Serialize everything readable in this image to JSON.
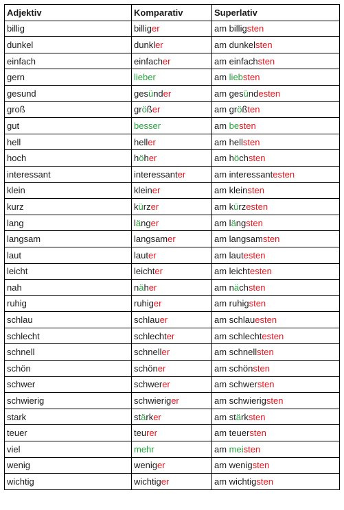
{
  "headers": [
    "Adjektiv",
    "Komparativ",
    "Superlativ"
  ],
  "colors": {
    "red": "#e8121b",
    "green": "#22a33a",
    "text": "#1a1a1a"
  },
  "rows": [
    {
      "adj": "billig",
      "komp": [
        [
          "billig",
          ""
        ],
        [
          "er",
          "r"
        ]
      ],
      "sup": [
        [
          "am billig",
          ""
        ],
        [
          "sten",
          "r"
        ]
      ]
    },
    {
      "adj": "dunkel",
      "komp": [
        [
          "dunkl",
          ""
        ],
        [
          "er",
          "r"
        ]
      ],
      "sup": [
        [
          "am dunkel",
          ""
        ],
        [
          "sten",
          "r"
        ]
      ]
    },
    {
      "adj": "einfach",
      "komp": [
        [
          "einfach",
          ""
        ],
        [
          "er",
          "r"
        ]
      ],
      "sup": [
        [
          "am einfach",
          ""
        ],
        [
          "sten",
          "r"
        ]
      ]
    },
    {
      "adj": "gern",
      "komp": [
        [
          "lieber",
          "g"
        ]
      ],
      "sup": [
        [
          "am ",
          ""
        ],
        [
          "lieb",
          "g"
        ],
        [
          "sten",
          "r"
        ]
      ]
    },
    {
      "adj": "gesund",
      "komp": [
        [
          "ges",
          ""
        ],
        [
          "ü",
          "g"
        ],
        [
          "nd",
          ""
        ],
        [
          "er",
          "r"
        ]
      ],
      "sup": [
        [
          "am ges",
          ""
        ],
        [
          "ü",
          "g"
        ],
        [
          "nd",
          ""
        ],
        [
          "esten",
          "r"
        ]
      ]
    },
    {
      "adj": "groß",
      "komp": [
        [
          "gr",
          ""
        ],
        [
          "ö",
          "g"
        ],
        [
          "ß",
          ""
        ],
        [
          "er",
          "r"
        ]
      ],
      "sup": [
        [
          "am gr",
          ""
        ],
        [
          "ö",
          "g"
        ],
        [
          "ß",
          ""
        ],
        [
          "ten",
          "r"
        ]
      ]
    },
    {
      "adj": "gut",
      "komp": [
        [
          "besser",
          "g"
        ]
      ],
      "sup": [
        [
          "am ",
          ""
        ],
        [
          "be",
          "g"
        ],
        [
          "sten",
          "r"
        ]
      ]
    },
    {
      "adj": "hell",
      "komp": [
        [
          "hell",
          ""
        ],
        [
          "er",
          "r"
        ]
      ],
      "sup": [
        [
          "am hell",
          ""
        ],
        [
          "sten",
          "r"
        ]
      ]
    },
    {
      "adj": "hoch",
      "komp": [
        [
          "h",
          ""
        ],
        [
          "ö",
          "g"
        ],
        [
          "h",
          ""
        ],
        [
          "er",
          "r"
        ]
      ],
      "sup": [
        [
          "am h",
          ""
        ],
        [
          "ö",
          "g"
        ],
        [
          "ch",
          ""
        ],
        [
          "sten",
          "r"
        ]
      ]
    },
    {
      "adj": "interessant",
      "komp": [
        [
          "interessant",
          ""
        ],
        [
          "er",
          "r"
        ]
      ],
      "sup": [
        [
          "am interessant",
          ""
        ],
        [
          "esten",
          "r"
        ]
      ]
    },
    {
      "adj": "klein",
      "komp": [
        [
          "klein",
          ""
        ],
        [
          "er",
          "r"
        ]
      ],
      "sup": [
        [
          "am klein",
          ""
        ],
        [
          "sten",
          "r"
        ]
      ]
    },
    {
      "adj": "kurz",
      "komp": [
        [
          "k",
          ""
        ],
        [
          "ü",
          "g"
        ],
        [
          "rz",
          ""
        ],
        [
          "er",
          "r"
        ]
      ],
      "sup": [
        [
          "am k",
          ""
        ],
        [
          "ü",
          "g"
        ],
        [
          "rz",
          ""
        ],
        [
          "esten",
          "r"
        ]
      ]
    },
    {
      "adj": "lang",
      "komp": [
        [
          "l",
          ""
        ],
        [
          "ä",
          "g"
        ],
        [
          "ng",
          ""
        ],
        [
          "er",
          "r"
        ]
      ],
      "sup": [
        [
          "am l",
          ""
        ],
        [
          "ä",
          "g"
        ],
        [
          "ng",
          ""
        ],
        [
          "sten",
          "r"
        ]
      ]
    },
    {
      "adj": "langsam",
      "komp": [
        [
          "langsam",
          ""
        ],
        [
          "er",
          "r"
        ]
      ],
      "sup": [
        [
          "am langsam",
          ""
        ],
        [
          "sten",
          "r"
        ]
      ]
    },
    {
      "adj": "laut",
      "komp": [
        [
          "laut",
          ""
        ],
        [
          "er",
          "r"
        ]
      ],
      "sup": [
        [
          "am laut",
          ""
        ],
        [
          "esten",
          "r"
        ]
      ]
    },
    {
      "adj": "leicht",
      "komp": [
        [
          "leicht",
          ""
        ],
        [
          "er",
          "r"
        ]
      ],
      "sup": [
        [
          "am leicht",
          ""
        ],
        [
          "esten",
          "r"
        ]
      ]
    },
    {
      "adj": "nah",
      "komp": [
        [
          "n",
          ""
        ],
        [
          "ä",
          "g"
        ],
        [
          "h",
          ""
        ],
        [
          "er",
          "r"
        ]
      ],
      "sup": [
        [
          "am n",
          ""
        ],
        [
          "ä",
          "g"
        ],
        [
          "ch",
          ""
        ],
        [
          "sten",
          "r"
        ]
      ]
    },
    {
      "adj": "ruhig",
      "komp": [
        [
          "ruhig",
          ""
        ],
        [
          "er",
          "r"
        ]
      ],
      "sup": [
        [
          "am ruhig",
          ""
        ],
        [
          "sten",
          "r"
        ]
      ]
    },
    {
      "adj": "schlau",
      "komp": [
        [
          "schlau",
          ""
        ],
        [
          "er",
          "r"
        ]
      ],
      "sup": [
        [
          "am schlau",
          ""
        ],
        [
          "esten",
          "r"
        ]
      ]
    },
    {
      "adj": "schlecht",
      "komp": [
        [
          "schlecht",
          ""
        ],
        [
          "er",
          "r"
        ]
      ],
      "sup": [
        [
          "am schlecht",
          ""
        ],
        [
          "esten",
          "r"
        ]
      ]
    },
    {
      "adj": "schnell",
      "komp": [
        [
          "schnell",
          ""
        ],
        [
          "er",
          "r"
        ]
      ],
      "sup": [
        [
          "am schnell",
          ""
        ],
        [
          "sten",
          "r"
        ]
      ]
    },
    {
      "adj": "schön",
      "komp": [
        [
          "schön",
          ""
        ],
        [
          "er",
          "r"
        ]
      ],
      "sup": [
        [
          "am schön",
          ""
        ],
        [
          "sten",
          "r"
        ]
      ]
    },
    {
      "adj": "schwer",
      "komp": [
        [
          "schwer",
          ""
        ],
        [
          "er",
          "r"
        ]
      ],
      "sup": [
        [
          "am schwer",
          ""
        ],
        [
          "sten",
          "r"
        ]
      ]
    },
    {
      "adj": "schwierig",
      "komp": [
        [
          "schwierig",
          ""
        ],
        [
          "er",
          "r"
        ]
      ],
      "sup": [
        [
          "am schwierig",
          ""
        ],
        [
          "sten",
          "r"
        ]
      ]
    },
    {
      "adj": "stark",
      "komp": [
        [
          "st",
          ""
        ],
        [
          "ä",
          "g"
        ],
        [
          "rk",
          ""
        ],
        [
          "er",
          "r"
        ]
      ],
      "sup": [
        [
          "am st",
          ""
        ],
        [
          "ä",
          "g"
        ],
        [
          "rk",
          ""
        ],
        [
          "sten",
          "r"
        ]
      ]
    },
    {
      "adj": "teuer",
      "komp": [
        [
          "teu",
          ""
        ],
        [
          "r",
          "r"
        ],
        [
          "er",
          "r"
        ]
      ],
      "sup": [
        [
          "am teuer",
          ""
        ],
        [
          "sten",
          "r"
        ]
      ]
    },
    {
      "adj": "viel",
      "komp": [
        [
          "mehr",
          "g"
        ]
      ],
      "sup": [
        [
          "am ",
          ""
        ],
        [
          "mei",
          "g"
        ],
        [
          "sten",
          "r"
        ]
      ]
    },
    {
      "adj": "wenig",
      "komp": [
        [
          "wenig",
          ""
        ],
        [
          "er",
          "r"
        ]
      ],
      "sup": [
        [
          "am wenig",
          ""
        ],
        [
          "sten",
          "r"
        ]
      ]
    },
    {
      "adj": "wichtig",
      "komp": [
        [
          "wichtig",
          ""
        ],
        [
          "er",
          "r"
        ]
      ],
      "sup": [
        [
          "am wichtig",
          ""
        ],
        [
          "sten",
          "r"
        ]
      ]
    }
  ]
}
